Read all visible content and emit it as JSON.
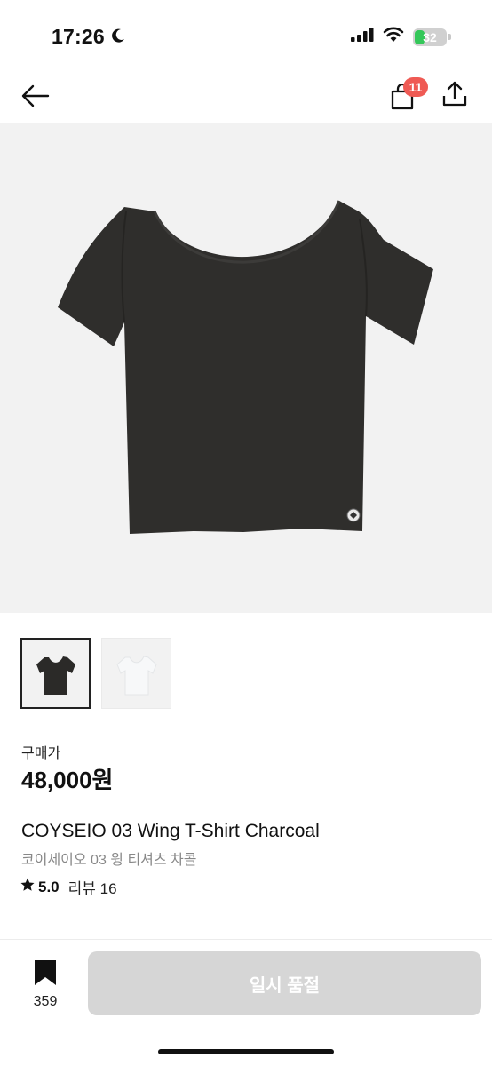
{
  "status_bar": {
    "time": "17:26",
    "battery": "32",
    "battery_level": 0.32,
    "icons": [
      "moon-icon",
      "signal-icon",
      "wifi-icon",
      "battery-icon"
    ]
  },
  "nav": {
    "back_icon": "arrow-left-icon",
    "cart_icon": "shopping-bag-icon",
    "cart_count": "11",
    "share_icon": "share-icon"
  },
  "product": {
    "image": "charcoal-tshirt",
    "thumbnails": [
      {
        "name": "charcoal",
        "color": "#2b2a28",
        "selected": true
      },
      {
        "name": "white",
        "color": "#f7f8f9",
        "selected": false
      }
    ],
    "price_label": "구매가",
    "price": "48,000원",
    "title_en": "COYSEIO 03 Wing T-Shirt Charcoal",
    "title_ko": "코이세이오 03 윙 티셔츠 차콜",
    "rating": "5.0",
    "review_label": "리뷰 16"
  },
  "bottom_bar": {
    "bookmark_icon": "bookmark-icon",
    "bookmark_count": "359",
    "soldout_label": "일시 품절"
  },
  "colors": {
    "badge": "#ef5a54",
    "soldout_button": "#d6d6d6",
    "image_bg": "#f2f2f2"
  }
}
